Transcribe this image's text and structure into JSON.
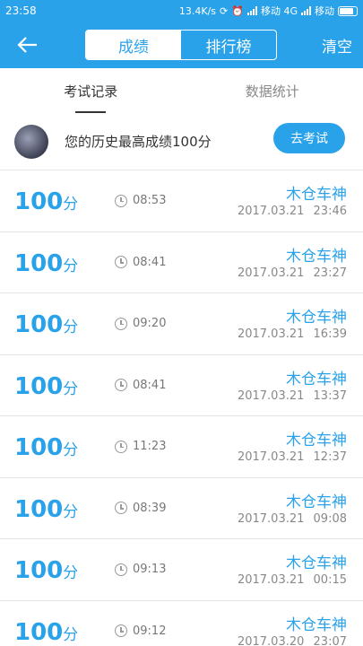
{
  "status": {
    "time": "23:58",
    "speed": "13.4K/s",
    "carrier1": "移动 4G",
    "carrier2": "移动"
  },
  "appbar": {
    "tabs": [
      "成绩",
      "排行榜"
    ],
    "clear": "清空"
  },
  "subtabs": [
    "考试记录",
    "数据统计"
  ],
  "best": {
    "text": "您的历史最高成绩100分",
    "button": "去考试"
  },
  "records": [
    {
      "score": "100",
      "unit": "分",
      "duration": "08:53",
      "name": "木仓车神",
      "date": "2017.03.21",
      "time": "23:46"
    },
    {
      "score": "100",
      "unit": "分",
      "duration": "08:41",
      "name": "木仓车神",
      "date": "2017.03.21",
      "time": "23:27"
    },
    {
      "score": "100",
      "unit": "分",
      "duration": "09:20",
      "name": "木仓车神",
      "date": "2017.03.21",
      "time": "16:39"
    },
    {
      "score": "100",
      "unit": "分",
      "duration": "08:41",
      "name": "木仓车神",
      "date": "2017.03.21",
      "time": "13:37"
    },
    {
      "score": "100",
      "unit": "分",
      "duration": "11:23",
      "name": "木仓车神",
      "date": "2017.03.21",
      "time": "12:37"
    },
    {
      "score": "100",
      "unit": "分",
      "duration": "08:39",
      "name": "木仓车神",
      "date": "2017.03.21",
      "time": "09:08"
    },
    {
      "score": "100",
      "unit": "分",
      "duration": "09:13",
      "name": "木仓车神",
      "date": "2017.03.21",
      "time": "00:15"
    },
    {
      "score": "100",
      "unit": "分",
      "duration": "09:12",
      "name": "木仓车神",
      "date": "2017.03.20",
      "time": "23:07"
    }
  ]
}
